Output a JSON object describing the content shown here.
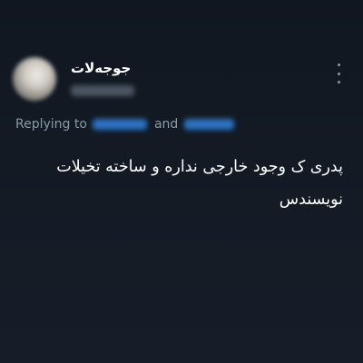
{
  "tweet": {
    "display_name": "جوجه‌لات",
    "reply_prefix": "Replying to",
    "reply_conjunction": "and",
    "text": "پدری ک وجود خارجی نداره و ساخته تخیلات نویسندس"
  }
}
